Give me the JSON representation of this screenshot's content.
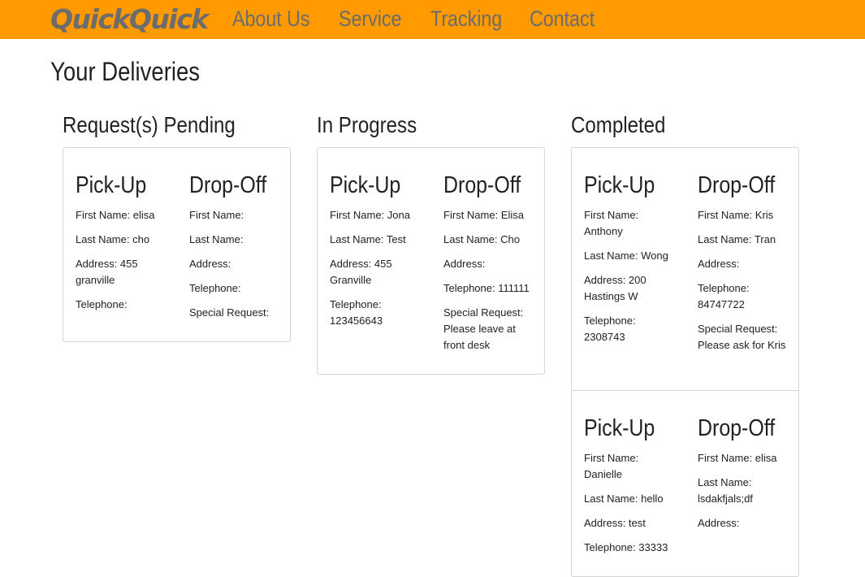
{
  "nav": {
    "brand": "QuickQuick",
    "links": [
      "About Us",
      "Service",
      "Tracking",
      "Contact"
    ]
  },
  "page": {
    "title": "Your Deliveries"
  },
  "columns": [
    {
      "title": "Request(s) Pending",
      "deliveries": [
        {
          "pickup": {
            "heading": "Pick-Up",
            "first_name": "First Name: elisa",
            "last_name": "Last Name: cho",
            "address": "Address: 455 granville",
            "telephone": "Telephone:"
          },
          "dropoff": {
            "heading": "Drop-Off",
            "first_name": "First Name:",
            "last_name": "Last Name:",
            "address": "Address:",
            "telephone": "Telephone:",
            "special_request": "Special Request:"
          }
        }
      ]
    },
    {
      "title": "In Progress",
      "deliveries": [
        {
          "pickup": {
            "heading": "Pick-Up",
            "first_name": "First Name: Jona",
            "last_name": "Last Name: Test",
            "address": "Address: 455 Granville",
            "telephone": "Telephone: 123456643"
          },
          "dropoff": {
            "heading": "Drop-Off",
            "first_name": "First Name: Elisa",
            "last_name": "Last Name: Cho",
            "address": "Address:",
            "telephone": "Telephone: 111111",
            "special_request": "Special Request: Please leave at front desk"
          }
        }
      ]
    },
    {
      "title": "Completed",
      "deliveries": [
        {
          "pickup": {
            "heading": "Pick-Up",
            "first_name": "First Name: Anthony",
            "last_name": "Last Name: Wong",
            "address": "Address: 200 Hastings W",
            "telephone": "Telephone: 2308743"
          },
          "dropoff": {
            "heading": "Drop-Off",
            "first_name": "First Name: Kris",
            "last_name": "Last Name: Tran",
            "address": "Address:",
            "telephone": "Telephone: 84747722",
            "special_request": "Special Request: Please ask for Kris"
          }
        },
        {
          "pickup": {
            "heading": "Pick-Up",
            "first_name": "First Name: Danielle",
            "last_name": "Last Name: hello",
            "address": "Address: test",
            "telephone": "Telephone: 33333"
          },
          "dropoff": {
            "heading": "Drop-Off",
            "first_name": "First Name: elisa",
            "last_name": "Last Name: lsdakfjals;df",
            "address": "Address:"
          }
        }
      ]
    }
  ],
  "colors": {
    "navbar": "#ff9a00",
    "nav_text": "#6c6c6c",
    "text": "#222222",
    "border": "#d6d6d6"
  }
}
